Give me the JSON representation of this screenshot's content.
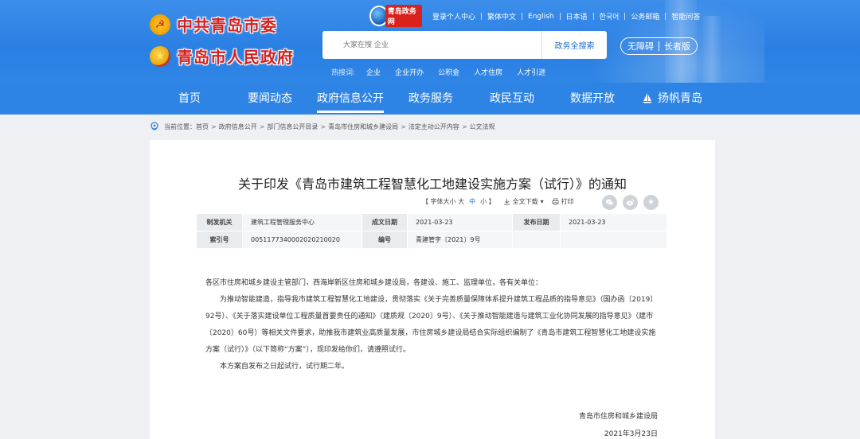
{
  "header": {
    "brand_line1": "中共青岛市委",
    "brand_line2": "青岛市人民政府",
    "site_logo_text": "青岛政务网",
    "toplinks": [
      "登录个人中心",
      "繁体中文",
      "English",
      "日本语",
      "한국어",
      "公务邮箱",
      "智能问答"
    ],
    "search_placeholder": "大家在搜 企业",
    "search_button": "政务全搜索",
    "hot_label": "热搜词:",
    "hot_words": [
      "企业",
      "企业开办",
      "公积金",
      "人才住房",
      "人才引进"
    ],
    "access_barrier_free": "无障碍",
    "access_elder": "长者版",
    "brand_red": "#d61f1f",
    "header_blue": "#2e84e5"
  },
  "nav": {
    "items": [
      "首页",
      "要闻动态",
      "政府信息公开",
      "政务服务",
      "政民互动",
      "数据开放",
      "扬帆青岛"
    ],
    "active_index": 2
  },
  "breadcrumb": {
    "label": "当前位置：",
    "items": [
      "首页",
      "政府信息公开",
      "部门信息公开目录",
      "青岛市住房和城乡建设局",
      "法定主动公开内容",
      "公文法规"
    ]
  },
  "article": {
    "title": "关于印发《青岛市建筑工程智慧化工地建设实施方案（试行）》的通知",
    "font_size_label": "【 字体大小 大",
    "font_mid": "中",
    "font_small": "小 】",
    "download_label": "全文下载",
    "print_label": "打印",
    "meta": {
      "issuer_label": "制发机关",
      "issuer_value": "建筑工程管理服务中心",
      "made_date_label": "成文日期",
      "made_date_value": "2021-03-23",
      "publish_date_label": "发布日期",
      "publish_date_value": "2021-03-23",
      "index_label": "索引号",
      "index_value": "0051177340002020210020",
      "number_label": "编号",
      "number_value": "青建管字〔2021〕9号"
    },
    "salutation": "各区市住房和城乡建设主管部门，西海岸新区住房和城乡建设局，各建设、施工、监理单位，各有关单位：",
    "paragraph1": "为推动智能建造，指导我市建筑工程智慧化工地建设，贯彻落实《关于完善质量保障体系提升建筑工程品质的指导意见》（国办函〔2019〕92号）、《关于落实建设单位工程质量首要责任的通知》（建质规〔2020〕9号）、《关于推动智能建造与建筑工业化协同发展的指导意见》（建市〔2020〕60号）等相关文件要求，助推我市建筑业高质量发展，市住房城乡建设局结合实际组织编制了《青岛市建筑工程智慧化工地建设实施方案（试行）》（以下简称“方案”），现印发给你们，请遵照试行。",
    "paragraph2": "本方案自发布之日起试行，试行期二年。",
    "sign_org": "青岛市住房和城乡建设局",
    "sign_date": "2021年3月23日"
  }
}
